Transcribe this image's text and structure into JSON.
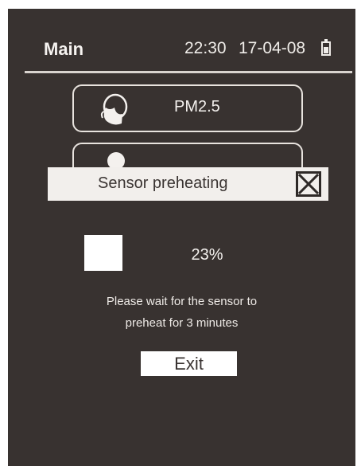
{
  "header": {
    "title": "Main",
    "time": "22:30",
    "date": "17-04-08",
    "battery_icon": "battery-icon"
  },
  "menu": {
    "items": [
      {
        "label": "PM2.5",
        "icon": "mask-icon"
      },
      {
        "label": "",
        "icon": "dot-icon"
      }
    ]
  },
  "dialog": {
    "title": "Sensor preheating",
    "close_icon": "close-icon",
    "progress_text": "23%",
    "progress_value": 0.23,
    "message_line1": "Please wait for the sensor to",
    "message_line2": "preheat for 3 minutes",
    "exit_label": "Exit"
  },
  "colors": {
    "screen_background": "#383230",
    "text": "#f4f1ee",
    "dialog_bar": "#f2efec"
  }
}
